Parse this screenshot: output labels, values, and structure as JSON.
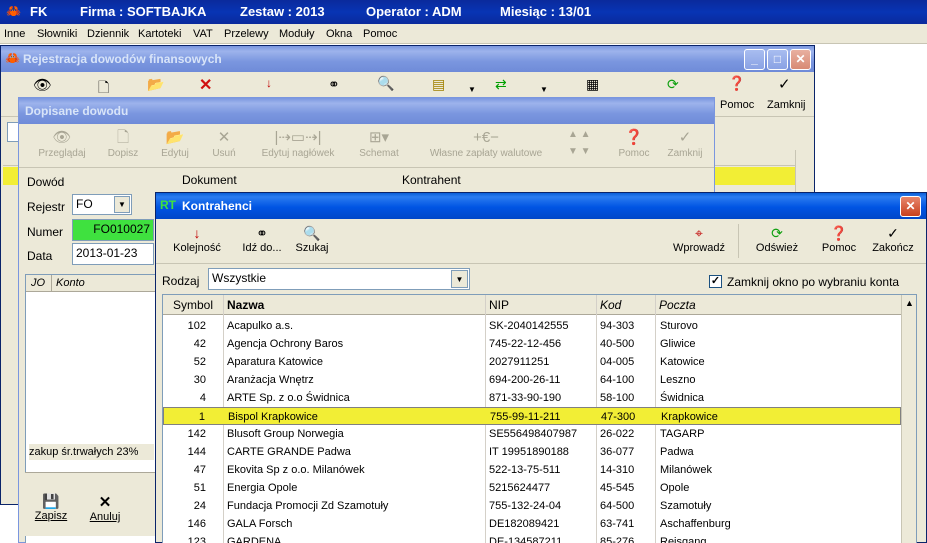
{
  "app": {
    "title_items": [
      "FK",
      "Firma : SOFTBAJKA",
      "Zestaw : 2013",
      "Operator : ADM",
      "Miesiąc : 13/01"
    ],
    "menu": [
      "Inne",
      "Słowniki",
      "Dziennik",
      "Kartoteki",
      "VAT",
      "Przelewy",
      "Moduły",
      "Okna",
      "Pomoc"
    ]
  },
  "w1": {
    "title": "Rejestracja dowodów finansowych",
    "toolbar": {
      "pomoc": "Pomoc",
      "zamknij": "Zamknij"
    }
  },
  "w2": {
    "title": "Dopisane dowodu",
    "toolbar": [
      "Przeglądaj",
      "Dopisz",
      "Edytuj",
      "Usuń",
      "Edytuj nagłówek",
      "Schemat",
      "Własne zapłaty walutowe",
      "Pomoc",
      "Zamknij"
    ],
    "labels": {
      "dowod": "Dowód",
      "dokument": "Dokument",
      "kontrahent": "Kontrahent",
      "rejestr": "Rejestr",
      "numer": "Numer",
      "data": "Data"
    },
    "values": {
      "rejestr": "FO",
      "numer": "FO010027",
      "data": "2013-01-23"
    },
    "table_headers": {
      "jo": "JO",
      "konto": "Konto"
    },
    "note": "zakup śr.trwałych 23%",
    "buttons": {
      "zapisz": "Zapisz",
      "anuluj": "Anuluj"
    }
  },
  "w3": {
    "title_prefix": "RT",
    "title": "Kontrahenci",
    "toolbar": {
      "kolejnosc": "Kolejność",
      "idzdo": "Idź do...",
      "szukaj": "Szukaj",
      "wprowadz": "Wprowadź",
      "odswiez": "Odśwież",
      "pomoc": "Pomoc",
      "zakoncz": "Zakończ"
    },
    "rodzaj_label": "Rodzaj",
    "rodzaj_value": "Wszystkie",
    "checkbox_label": "Zamknij okno po wybraniu konta",
    "checkbox_checked": true,
    "columns": [
      "Symbol",
      "Nazwa",
      "NIP",
      "Kod",
      "Poczta"
    ],
    "rows": [
      {
        "symbol": "102",
        "nazwa": "Acapulko  a.s.",
        "nip": "SK-2040142555",
        "kod": "94-303",
        "poczta": "Sturovo"
      },
      {
        "symbol": "42",
        "nazwa": "Agencja Ochrony Baros",
        "nip": "745-22-12-456",
        "kod": "40-500",
        "poczta": "Gliwice"
      },
      {
        "symbol": "52",
        "nazwa": "Aparatura Katowice",
        "nip": "2027911251",
        "kod": "04-005",
        "poczta": "Katowice"
      },
      {
        "symbol": "30",
        "nazwa": "Aranżacja Wnętrz",
        "nip": "694-200-26-11",
        "kod": "64-100",
        "poczta": "Leszno"
      },
      {
        "symbol": "4",
        "nazwa": "ARTE Sp. z o.o Świdnica",
        "nip": "871-33-90-190",
        "kod": "58-100",
        "poczta": "Świdnica"
      },
      {
        "symbol": "1",
        "nazwa": "Bispol Krapkowice",
        "nip": "755-99-11-211",
        "kod": "47-300",
        "poczta": "Krapkowice"
      },
      {
        "symbol": "142",
        "nazwa": "Blusoft Group  Norwegia",
        "nip": "SE556498407987",
        "kod": "26-022",
        "poczta": "TAGARP"
      },
      {
        "symbol": "144",
        "nazwa": "CARTE GRANDE Padwa",
        "nip": "IT 19951890188",
        "kod": "36-077",
        "poczta": "Padwa"
      },
      {
        "symbol": "47",
        "nazwa": "Ekovita Sp z o.o. Milanówek",
        "nip": "522-13-75-511",
        "kod": "14-310",
        "poczta": "Milanówek"
      },
      {
        "symbol": "51",
        "nazwa": "Energia Opole",
        "nip": "5215624477",
        "kod": "45-545",
        "poczta": "Opole"
      },
      {
        "symbol": "24",
        "nazwa": "Fundacja Promocji Zd Szamotuły",
        "nip": "755-132-24-04",
        "kod": "64-500",
        "poczta": "Szamotuły"
      },
      {
        "symbol": "146",
        "nazwa": "GALA  Forsch",
        "nip": "DE182089421",
        "kod": "63-741",
        "poczta": "Aschaffenburg"
      },
      {
        "symbol": "123",
        "nazwa": "GARDENA",
        "nip": "DE-134587211",
        "kod": "85-276",
        "poczta": "Reisgang"
      }
    ],
    "selected_row": 5,
    "colors": {
      "selected": "#f2ee35",
      "numer_bg": "#3fe13f"
    }
  }
}
